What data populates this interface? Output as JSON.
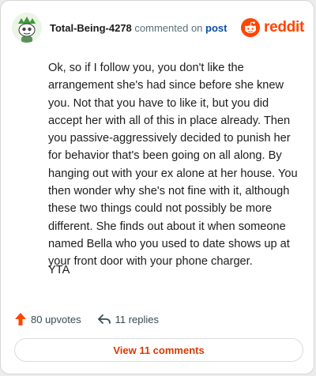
{
  "comment": {
    "username": "Total-Being-4278",
    "action_text": "commented on",
    "target_text": "post",
    "body": "Ok, so if I follow you, you don't like the arrangement she's had since before she knew you. Not that you have to like it, but you did accept her with all of this in place already. Then you passive-aggressively decided to punish her for behavior that's been going on all along. By hanging out with your ex alone at her house. You then wonder why she's not fine with it, although these two things could not possibly be more different. She finds out about it when someone named Bella who you used to date shows up at your front door with your phone charger.",
    "verdict": "YTA",
    "upvotes": "80 upvotes",
    "replies": "11 replies",
    "view_button": "View 11 comments"
  },
  "brand": {
    "logo_text": "reddit",
    "logo_icon": "reddit-snoo-icon",
    "accent_color": "#ff4500"
  },
  "icons": {
    "upvote": "upvote-arrow-icon",
    "reply": "reply-arrow-icon",
    "avatar": "snoo-avatar"
  },
  "colors": {
    "link": "#0a4fa8",
    "button_text": "#d93900",
    "muted": "#576f76"
  }
}
